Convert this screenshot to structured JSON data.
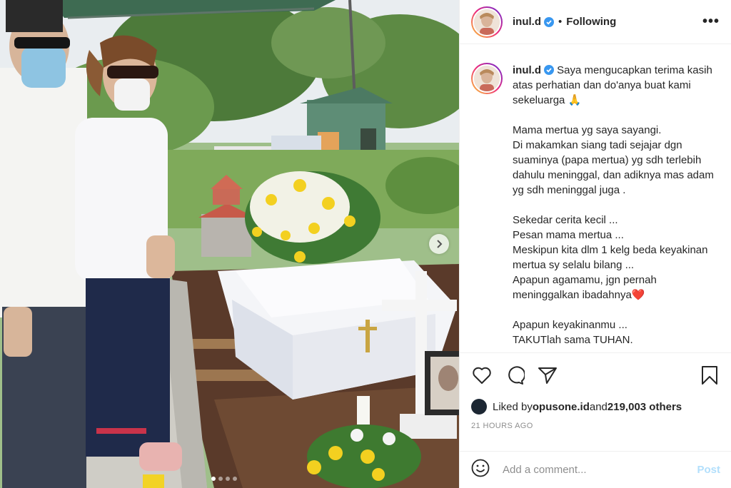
{
  "post": {
    "username": "inul.d",
    "separator": "•",
    "follow_status": "Following",
    "more_label": "•••"
  },
  "caption": {
    "username": "inul.d",
    "text": " Saya mengucapkan terima kasih atas perhatian dan do'anya buat kami sekeluarga 🙏\n\nMama mertua yg saya sayangi.\nDi makamkan siang tadi sejajar dgn suaminya (papa mertua) yg sdh terlebih dahulu meninggal, dan adiknya mas adam yg sdh meninggal juga .\n\nSekedar cerita kecil ...\nPesan mama mertua ...\nMeskipun kita dlm 1 kelg beda keyakinan mertua sy selalu bilang ...\nApapun agamamu, jgn pernah meninggalkan ibadahnya❤️\n\nApapun keyakinanmu ...\nTAKUTlah sama TUHAN."
  },
  "likes": {
    "prefix": "Liked by ",
    "liker": "opusone.id",
    "joiner": " and ",
    "others": "219,003 others"
  },
  "time_ago": "21 HOURS AGO",
  "comment": {
    "placeholder": "Add a comment...",
    "post_label": "Post"
  },
  "carousel": {
    "slides": 4,
    "active_slide": 1
  },
  "colors": {
    "verified": "#3897f0",
    "post_disabled": "#b2dffc",
    "heart": "#ed4956"
  },
  "icons": [
    "verified-icon",
    "like-icon",
    "comment-icon",
    "share-icon",
    "save-icon",
    "emoji-icon",
    "chevron-right-icon"
  ]
}
